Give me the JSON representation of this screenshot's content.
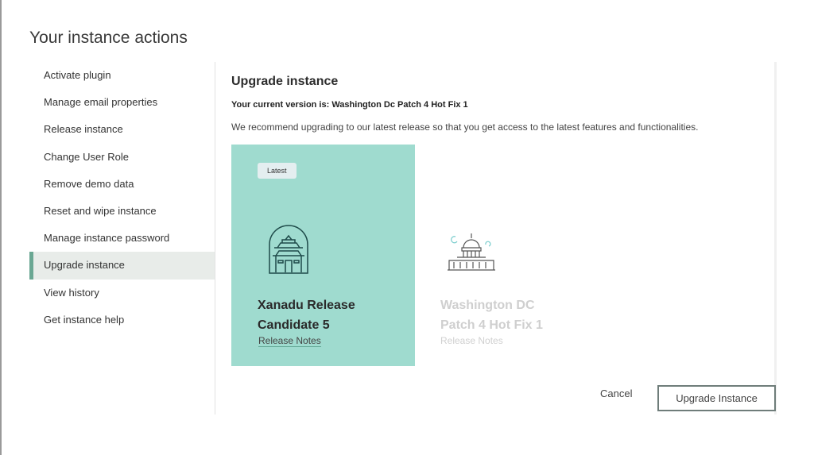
{
  "title": "Your instance actions",
  "sidebar": {
    "items": [
      {
        "label": "Activate plugin"
      },
      {
        "label": "Manage email properties"
      },
      {
        "label": "Release instance"
      },
      {
        "label": "Change User Role"
      },
      {
        "label": "Remove demo data"
      },
      {
        "label": "Reset and wipe instance"
      },
      {
        "label": "Manage instance password"
      },
      {
        "label": "Upgrade instance",
        "active": true
      },
      {
        "label": "View history"
      },
      {
        "label": "Get instance help"
      }
    ]
  },
  "main": {
    "heading": "Upgrade instance",
    "current_version": "Your current version is: Washington Dc Patch 4 Hot Fix 1",
    "recommendation": "We recommend upgrading to our latest release so that you get access to the latest features and functionalities.",
    "cards": [
      {
        "badge": "Latest",
        "name_line1": "Xanadu Release",
        "name_line2": "Candidate 5",
        "notes": "Release Notes",
        "icon": "xanadu-temple-icon",
        "icon_text": "XANADU RELEASE",
        "selected": true
      },
      {
        "name_line1": "Washington DC",
        "name_line2": "Patch 4 Hot Fix 1",
        "notes": "Release Notes",
        "icon": "capitol-building-icon"
      }
    ],
    "cancel": "Cancel",
    "upgrade": "Upgrade Instance"
  },
  "colors": {
    "accent": "#9fdbcf",
    "active_bar": "#6aa793"
  }
}
